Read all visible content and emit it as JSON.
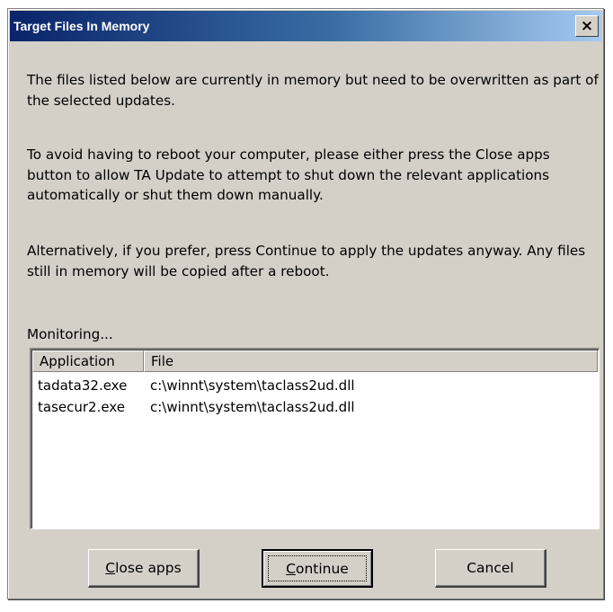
{
  "window": {
    "title": "Target Files In Memory",
    "close_glyph": "×"
  },
  "body": {
    "paragraph1": "The files listed below are currently in memory but need to be overwritten as part of the selected updates.",
    "paragraph2": "To avoid having to reboot your computer, please either press the Close apps button to allow TA Update to attempt to shut down the relevant applications automatically or shut them down manually.",
    "paragraph3": "Alternatively, if you prefer, press Continue to apply the updates anyway. Any files still in memory will be copied after a reboot.",
    "status": "Monitoring..."
  },
  "list": {
    "columns": [
      "Application",
      "File"
    ],
    "rows": [
      {
        "application": "tadata32.exe",
        "file": "c:\\winnt\\system\\taclass2ud.dll"
      },
      {
        "application": "tasecur2.exe",
        "file": "c:\\winnt\\system\\taclass2ud.dll"
      }
    ]
  },
  "buttons": {
    "close_apps": {
      "mnemonic": "C",
      "rest": "lose apps"
    },
    "continue": {
      "mnemonic": "C",
      "rest": "ontinue"
    },
    "cancel": {
      "label": "Cancel"
    }
  },
  "colors": {
    "titlebar_start": "#0a246a",
    "titlebar_end": "#a6caf0",
    "dialog_face": "#d4d0c8"
  },
  "icons": {
    "close": "close-icon"
  }
}
